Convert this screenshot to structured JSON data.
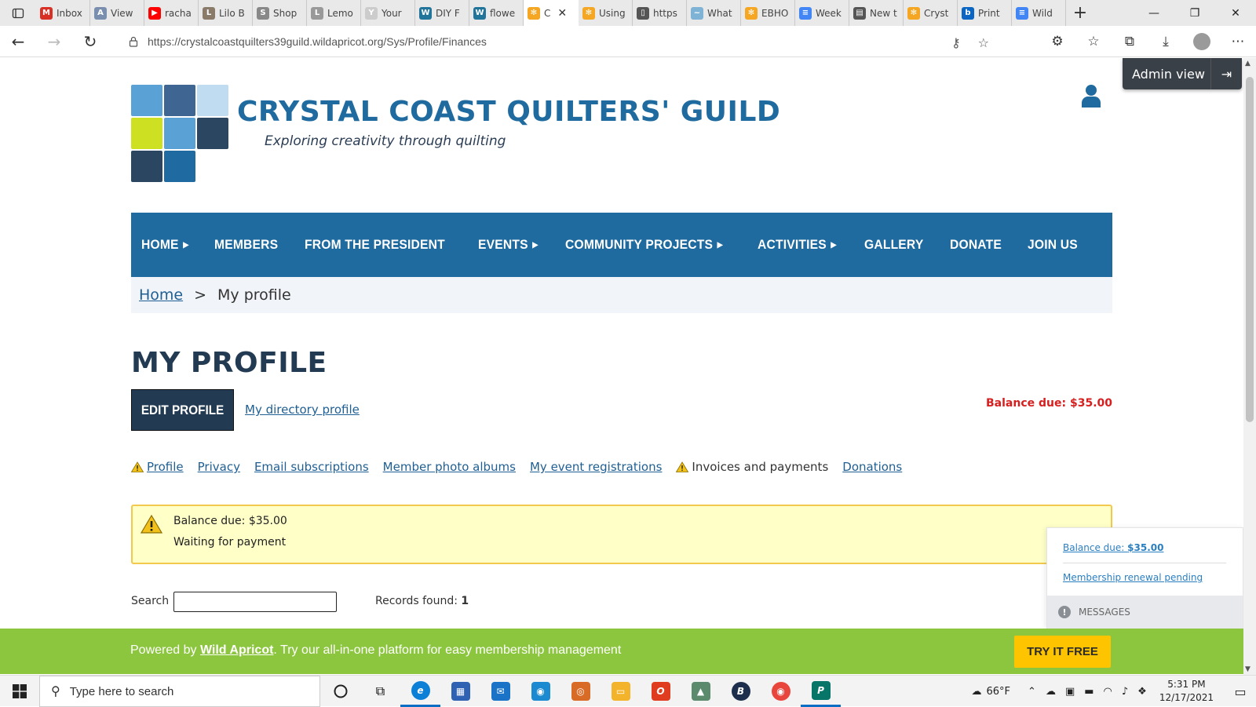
{
  "browser": {
    "tabs": [
      {
        "label": "Inbox",
        "color": "#d93025",
        "glyph": "M"
      },
      {
        "label": "View",
        "color": "#7a8fb0",
        "glyph": "A"
      },
      {
        "label": "racha",
        "color": "#ff0000",
        "glyph": "▶"
      },
      {
        "label": "Lilo B",
        "color": "#8a7a6a",
        "glyph": "L"
      },
      {
        "label": "Shop",
        "color": "#888888",
        "glyph": "S"
      },
      {
        "label": "Lemo",
        "color": "#999999",
        "glyph": "L"
      },
      {
        "label": "Your",
        "color": "#cccccc",
        "glyph": "Y"
      },
      {
        "label": "DIY F",
        "color": "#21759b",
        "glyph": "W"
      },
      {
        "label": "flowe",
        "color": "#21759b",
        "glyph": "W"
      },
      {
        "label": "C",
        "color": "#f5a623",
        "glyph": "✻",
        "active": true
      },
      {
        "label": "Using",
        "color": "#f5a623",
        "glyph": "✻"
      },
      {
        "label": "https",
        "color": "#555555",
        "glyph": "▯"
      },
      {
        "label": "What",
        "color": "#7fb3d5",
        "glyph": "~"
      },
      {
        "label": "EBHO",
        "color": "#f5a623",
        "glyph": "✻"
      },
      {
        "label": "Week",
        "color": "#4285f4",
        "glyph": "≡"
      },
      {
        "label": "New t",
        "color": "#555555",
        "glyph": "▤"
      },
      {
        "label": "Cryst",
        "color": "#f5a623",
        "glyph": "✻"
      },
      {
        "label": "Print",
        "color": "#0a66c2",
        "glyph": "b"
      },
      {
        "label": "Wild",
        "color": "#4285f4",
        "glyph": "≡"
      }
    ],
    "url": "https://crystalcoastquilters39guild.wildapricot.org/Sys/Profile/Finances"
  },
  "site": {
    "title": "CRYSTAL COAST QUILTERS' GUILD",
    "tagline": "Exploring creativity through quilting",
    "logo_colors": [
      "#5aa2d6",
      "#3f6693",
      "#bfdcf1",
      "#cde021",
      "#5aa2d6",
      "#2b4660",
      "#2b4660",
      "#1f6aa0"
    ],
    "admin_view": "Admin view"
  },
  "nav": {
    "items": [
      {
        "label": "HOME",
        "submenu": true
      },
      {
        "label": "MEMBERS",
        "submenu": false
      },
      {
        "label": "FROM THE PRESIDENT",
        "submenu": false
      },
      {
        "label": "EVENTS",
        "submenu": true
      },
      {
        "label": "COMMUNITY PROJECTS",
        "submenu": true
      },
      {
        "label": "ACTIVITIES",
        "submenu": true
      },
      {
        "label": "GALLERY",
        "submenu": false
      },
      {
        "label": "DONATE",
        "submenu": false
      },
      {
        "label": "JOIN US",
        "submenu": false
      }
    ]
  },
  "breadcrumb": {
    "home": "Home",
    "sep": ">",
    "current": "My profile"
  },
  "profile": {
    "heading": "MY PROFILE",
    "edit_button": "EDIT PROFILE",
    "directory_link": "My directory profile",
    "balance_due": "Balance due: $35.00"
  },
  "subnav": [
    {
      "label": "Profile",
      "warn": true,
      "current": false
    },
    {
      "label": "Privacy",
      "warn": false,
      "current": false
    },
    {
      "label": "Email subscriptions",
      "warn": false,
      "current": false
    },
    {
      "label": "Member photo albums",
      "warn": false,
      "current": false
    },
    {
      "label": "My event registrations",
      "warn": false,
      "current": false
    },
    {
      "label": "Invoices and payments",
      "warn": true,
      "current": true
    },
    {
      "label": "Donations",
      "warn": false,
      "current": false
    }
  ],
  "alert": {
    "line1": "Balance due: $35.00",
    "line2": "Waiting for payment"
  },
  "search": {
    "label": "Search",
    "value": "",
    "records_label": "Records found:",
    "records_count": "1"
  },
  "messages": {
    "balance_prefix": "Balance due: ",
    "balance_amount": "$35.00",
    "renewal": "Membership renewal pending",
    "footer": "MESSAGES"
  },
  "promo": {
    "prefix": "Powered by ",
    "brand": "Wild Apricot",
    "suffix": ". Try our all-in-one platform for easy membership management",
    "button": "TRY IT FREE"
  },
  "taskbar": {
    "search_placeholder": "Type here to search",
    "weather": "66°F",
    "time": "5:31 PM",
    "date": "12/17/2021"
  }
}
